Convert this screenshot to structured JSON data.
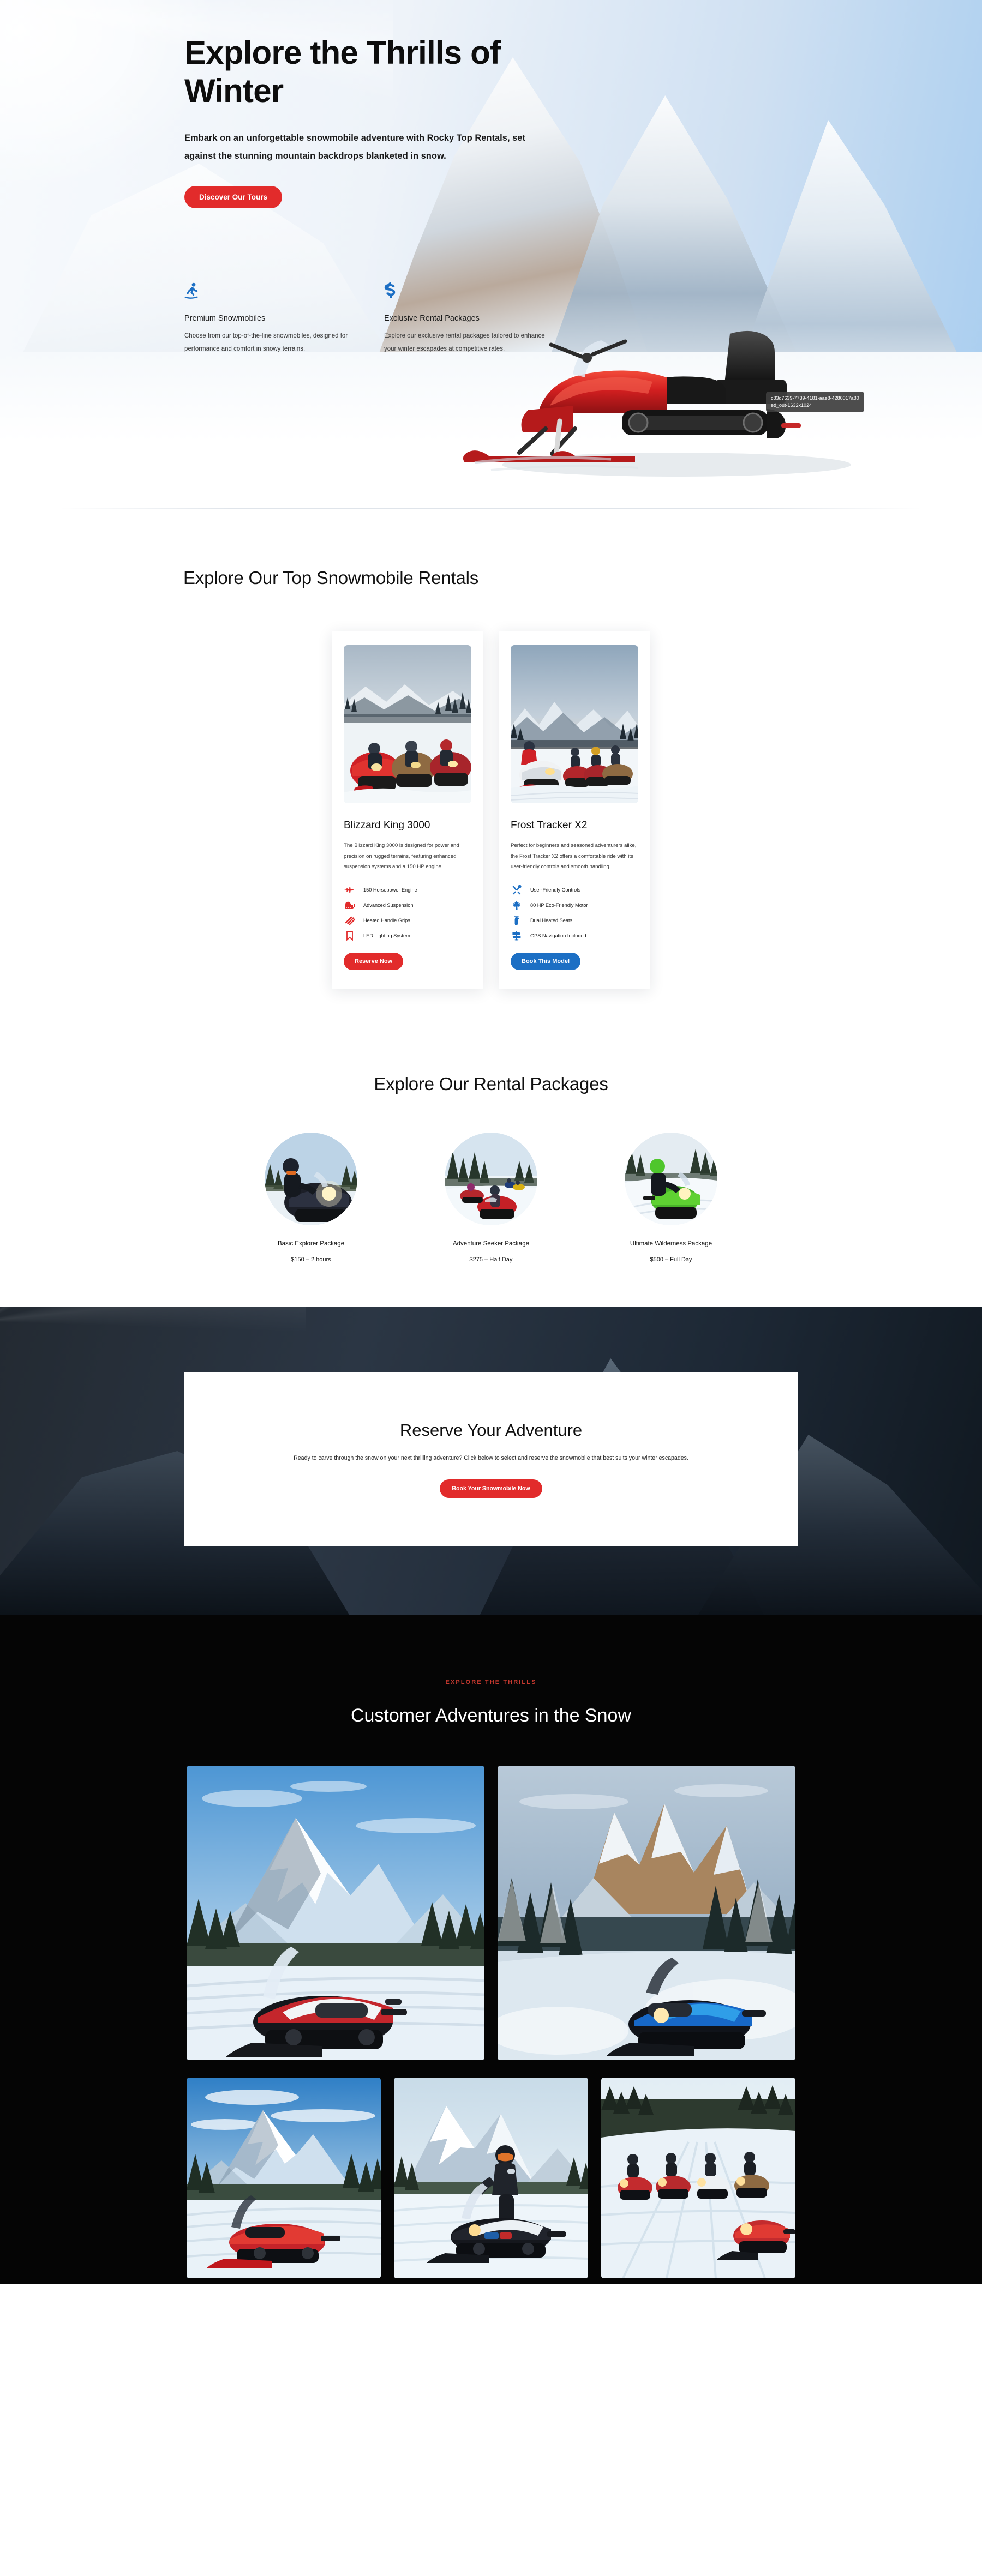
{
  "hero": {
    "title": "Explore the Thrills of Winter",
    "subtitle": "Embark on an unforgettable snowmobile adventure with Rocky Top Rentals, set against the stunning mountain backdrops blanketed in snow.",
    "cta_label": "Discover Our Tours",
    "tooltip": "c83d7639-7739-4181-aae8-4280017a80ed_out-1632x1024",
    "features": [
      {
        "icon": "snowboarder-icon",
        "title": "Premium Snowmobiles",
        "body": "Choose from our top-of-the-line snowmobiles, designed for performance and comfort in snowy terrains."
      },
      {
        "icon": "dollar-sign-icon",
        "title": "Exclusive Rental Packages",
        "body": "Explore our exclusive rental packages tailored to enhance your winter escapades at competitive rates."
      }
    ]
  },
  "rentals": {
    "heading": "Explore Our Top Snowmobile Rentals",
    "cards": [
      {
        "title": "Blizzard King 3000",
        "description": "The Blizzard King 3000 is designed for power and precision on rugged terrains, featuring enhanced suspension systems and a 150 HP engine.",
        "specs": [
          {
            "icon": "jet-fighter-icon",
            "label": "150 Horsepower Engine"
          },
          {
            "icon": "bulldozer-icon",
            "label": "Advanced Suspension"
          },
          {
            "icon": "stripes-icon",
            "label": "Heated Handle Grips"
          },
          {
            "icon": "bookmark-icon",
            "label": "LED Lighting System"
          }
        ],
        "button_label": "Reserve Now",
        "button_color": "#e22b2b",
        "accent": "#e22b2b"
      },
      {
        "title": "Frost Tracker X2",
        "description": "Perfect for beginners and seasoned adventurers alike, the Frost Tracker X2 offers a comfortable ride with its user-friendly controls and smooth handling.",
        "specs": [
          {
            "icon": "tools-icon",
            "label": "User-Friendly Controls"
          },
          {
            "icon": "maple-leaf-icon",
            "label": "80 HP Eco-Friendly Motor"
          },
          {
            "icon": "fire-extinguisher-icon",
            "label": "Dual Heated Seats"
          },
          {
            "icon": "signpost-icon",
            "label": "GPS Navigation Included"
          }
        ],
        "button_label": "Book This Model",
        "button_color": "#1c6fc4",
        "accent": "#1c6fc4"
      }
    ]
  },
  "packages": {
    "heading": "Explore Our Rental Packages",
    "items": [
      {
        "name": "Basic Explorer Package",
        "price": "$150 – 2 hours"
      },
      {
        "name": "Adventure Seeker Package",
        "price": "$275 – Half Day"
      },
      {
        "name": "Ultimate Wilderness Package",
        "price": "$500 – Full Day"
      }
    ]
  },
  "cta": {
    "title": "Reserve Your Adventure",
    "body": "Ready to carve through the snow on your next thrilling adventure? Click below to select and reserve the snowmobile that best suits your winter escapades.",
    "button_label": "Book Your Snowmobile Now"
  },
  "gallery": {
    "eyebrow": "EXPLORE THE THRILLS",
    "heading": "Customer Adventures in the Snow",
    "row_a": [
      {
        "alt": "red-snowmobile-mountain-peak-photo"
      },
      {
        "alt": "blue-snowmobile-forest-valley-photo"
      }
    ],
    "row_b": [
      {
        "alt": "red-snowmobile-trail-photo"
      },
      {
        "alt": "rider-standing-snowmobile-photo"
      },
      {
        "alt": "group-riders-snow-road-photo"
      }
    ]
  },
  "colors": {
    "accent_red": "#e22b2b",
    "accent_blue": "#1c6fc4",
    "eyebrow_red": "#c7392f",
    "gallery_bg": "#050505"
  }
}
